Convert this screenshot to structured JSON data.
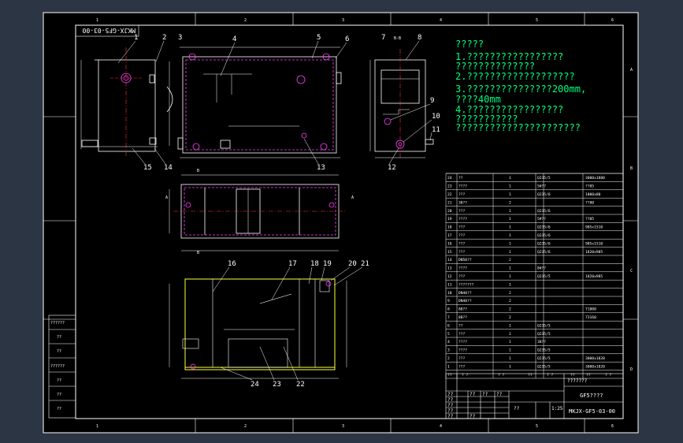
{
  "drawing": {
    "stamp": "MKJX-GF5-03-00",
    "zone_numbers": [
      "1",
      "2",
      "3",
      "4",
      "5",
      "6"
    ],
    "zone_letters": [
      "A",
      "B",
      "C",
      "D"
    ]
  },
  "notes": {
    "title": "?????",
    "lines": [
      "1.?????????????????",
      "  ??????????????",
      "2.???????????????????",
      "3.???????????????200mm,",
      "  ????40mm",
      "4.?????????????????",
      "  ???????????",
      "  ??????????????????????"
    ]
  },
  "balloons": {
    "top_view": [
      "1",
      "2",
      "3",
      "4",
      "5",
      "6",
      "13",
      "14",
      "15"
    ],
    "side_view": [
      "7",
      "8",
      "9",
      "10",
      "11",
      "12"
    ],
    "section_view": [
      "16",
      "17",
      "18",
      "19",
      "20",
      "21",
      "22",
      "23",
      "24"
    ],
    "section_marks": [
      "B-B",
      "B",
      "B",
      "A",
      "A"
    ]
  },
  "parts_table": {
    "rows": [
      {
        "no": "24",
        "name": "??",
        "qty": "1",
        "material": "Q235/5",
        "remark": "3000x1800"
      },
      {
        "no": "23",
        "name": "????",
        "qty": "1",
        "material": "5#??",
        "remark": "??05"
      },
      {
        "no": "22",
        "name": "???",
        "qty": "1",
        "material": "Q235/6",
        "remark": "1000x80"
      },
      {
        "no": "21",
        "name": "38??",
        "qty": "2",
        "material": "",
        "remark": "??80"
      },
      {
        "no": "20",
        "name": "???",
        "qty": "1",
        "material": "Q235/6",
        "remark": ""
      },
      {
        "no": "19",
        "name": "????",
        "qty": "1",
        "material": "5#??",
        "remark": "??05"
      },
      {
        "no": "18",
        "name": "???",
        "qty": "1",
        "material": "Q235/6",
        "remark": "985x1510"
      },
      {
        "no": "17",
        "name": "???",
        "qty": "1",
        "material": "Q235/6",
        "remark": ""
      },
      {
        "no": "16",
        "name": "???",
        "qty": "1",
        "material": "Q235/6",
        "remark": "985x1510"
      },
      {
        "no": "15",
        "name": "???",
        "qty": "1",
        "material": "Q235/6",
        "remark": "1820x985"
      },
      {
        "no": "14",
        "name": "DN50??",
        "qty": "2",
        "material": "",
        "remark": ""
      },
      {
        "no": "13",
        "name": "????",
        "qty": "1",
        "material": "8#??",
        "remark": ""
      },
      {
        "no": "12",
        "name": "???",
        "qty": "1",
        "material": "Q235/5",
        "remark": "1820x985"
      },
      {
        "no": "11",
        "name": "???????",
        "qty": "1",
        "material": "",
        "remark": ""
      },
      {
        "no": "10",
        "name": "DN40??",
        "qty": "2",
        "material": "",
        "remark": ""
      },
      {
        "no": "9",
        "name": "DN40??",
        "qty": "2",
        "material": "",
        "remark": ""
      },
      {
        "no": "8",
        "name": "88??",
        "qty": "2",
        "material": "",
        "remark": "71800"
      },
      {
        "no": "7",
        "name": "88??",
        "qty": "2",
        "material": "",
        "remark": "73160"
      },
      {
        "no": "6",
        "name": "??",
        "qty": "1",
        "material": "Q235/5",
        "remark": ""
      },
      {
        "no": "5",
        "name": "???",
        "qty": "1",
        "material": "Q235/5",
        "remark": ""
      },
      {
        "no": "4",
        "name": "????",
        "qty": "1",
        "material": "38??",
        "remark": ""
      },
      {
        "no": "3",
        "name": "????",
        "qty": "1",
        "material": "Q235/5",
        "remark": ""
      },
      {
        "no": "2",
        "name": "???",
        "qty": "1",
        "material": "Q235/5",
        "remark": "3000x1820"
      },
      {
        "no": "1",
        "name": "???",
        "qty": "1",
        "material": "Q235/5",
        "remark": "3000x1820"
      }
    ],
    "header": {
      "no": "??",
      "code": "? ?",
      "name": "? ?",
      "qty": "??",
      "material": "? ?",
      "unit": "??",
      "total": "??",
      "remark": "? ?"
    }
  },
  "title_block": {
    "unit_name": "???????",
    "drawing_name": "GF5????",
    "drawing_no": "MKJX-GF5-03-00",
    "scale": "1:25",
    "left_labels": [
      "??",
      "??",
      "??",
      "??",
      "??",
      "??",
      "??",
      "??",
      "??"
    ],
    "scale_label": "??"
  },
  "side_block": {
    "labels": [
      "??????",
      "??",
      "??",
      "??????",
      "??",
      "??",
      "??"
    ]
  }
}
